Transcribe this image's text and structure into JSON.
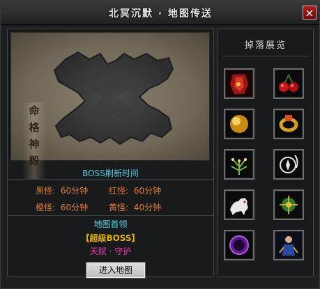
{
  "window": {
    "title": "北冥沉默 · 地图传送",
    "close_glyph": "×"
  },
  "map": {
    "banner": "命格神殿"
  },
  "boss": {
    "header": "BOSS刷新时间",
    "rates": [
      {
        "label": "黑怪:",
        "value": "60分钟"
      },
      {
        "label": "红怪:",
        "value": "60分钟"
      },
      {
        "label": "橙怪:",
        "value": "60分钟"
      },
      {
        "label": "黄怪:",
        "value": "40分钟"
      }
    ],
    "leader_header": "地图首领",
    "super_boss": "【超级BOSS】",
    "talent": "天赋 · 守护"
  },
  "enter_button": "进入地图",
  "drops": {
    "title": "掉落展览",
    "items": [
      {
        "icon": "red-robe-icon"
      },
      {
        "icon": "cherry-icon"
      },
      {
        "icon": "gold-orb-icon"
      },
      {
        "icon": "gold-ring-icon"
      },
      {
        "icon": "green-plant-icon"
      },
      {
        "icon": "compass-icon"
      },
      {
        "icon": "white-beast-icon"
      },
      {
        "icon": "green-gem-icon"
      },
      {
        "icon": "purple-orb-icon"
      },
      {
        "icon": "monk-figure-icon"
      }
    ]
  },
  "colors": {
    "accent_cyan": "#50d6e8",
    "orange": "#e07b2d",
    "gold": "#e7b200",
    "pink": "#e23da6"
  }
}
